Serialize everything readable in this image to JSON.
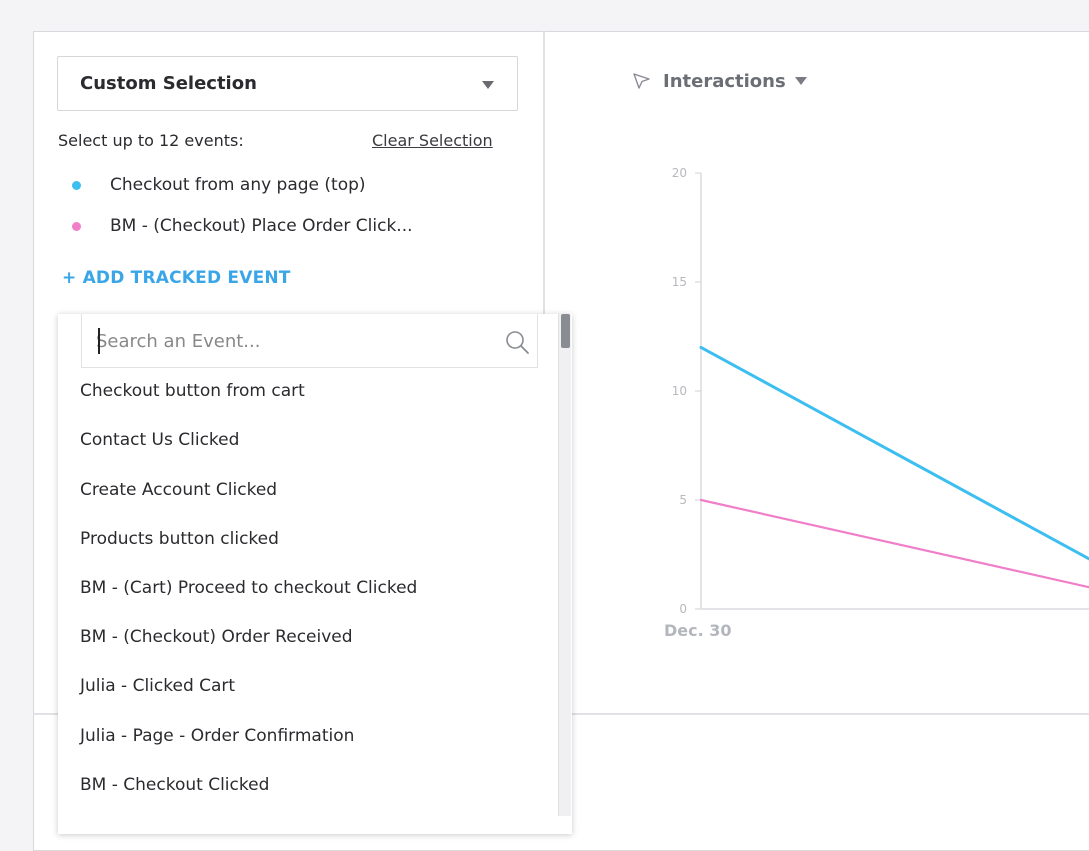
{
  "selection": {
    "label": "Custom Selection",
    "hint": "Select up to 12 events:",
    "clear_label": "Clear Selection",
    "selected_events": [
      {
        "label": "Checkout from any page (top)",
        "color": "#3cbff0"
      },
      {
        "label": "BM - (Checkout) Place Order Click...",
        "color": "#f07ec8"
      }
    ],
    "add_label": "+ ADD TRACKED EVENT"
  },
  "dropdown": {
    "search_placeholder": "Search an Event...",
    "events": [
      "Checkout button from cart",
      "Contact Us Clicked",
      "Create Account Clicked",
      "Products button clicked",
      "BM - (Cart) Proceed to checkout Clicked",
      "BM - (Checkout) Order Received",
      "Julia - Clicked Cart",
      "Julia - Page - Order Confirmation",
      "BM - Checkout Clicked"
    ]
  },
  "metric": {
    "icon": "cursor-arrow-icon",
    "label": "Interactions"
  },
  "chart_data": {
    "type": "line",
    "x": [
      "Dec. 30"
    ],
    "ylim": [
      0,
      20
    ],
    "yticks": [
      "0",
      "5",
      "10",
      "15",
      "20"
    ],
    "xtick_label": "Dec. 30",
    "grid": false,
    "series": [
      {
        "values": [
          12,
          2.3
        ],
        "color": "#3cbff0"
      },
      {
        "values": [
          5,
          1
        ],
        "color": "#f07ec8"
      }
    ]
  }
}
